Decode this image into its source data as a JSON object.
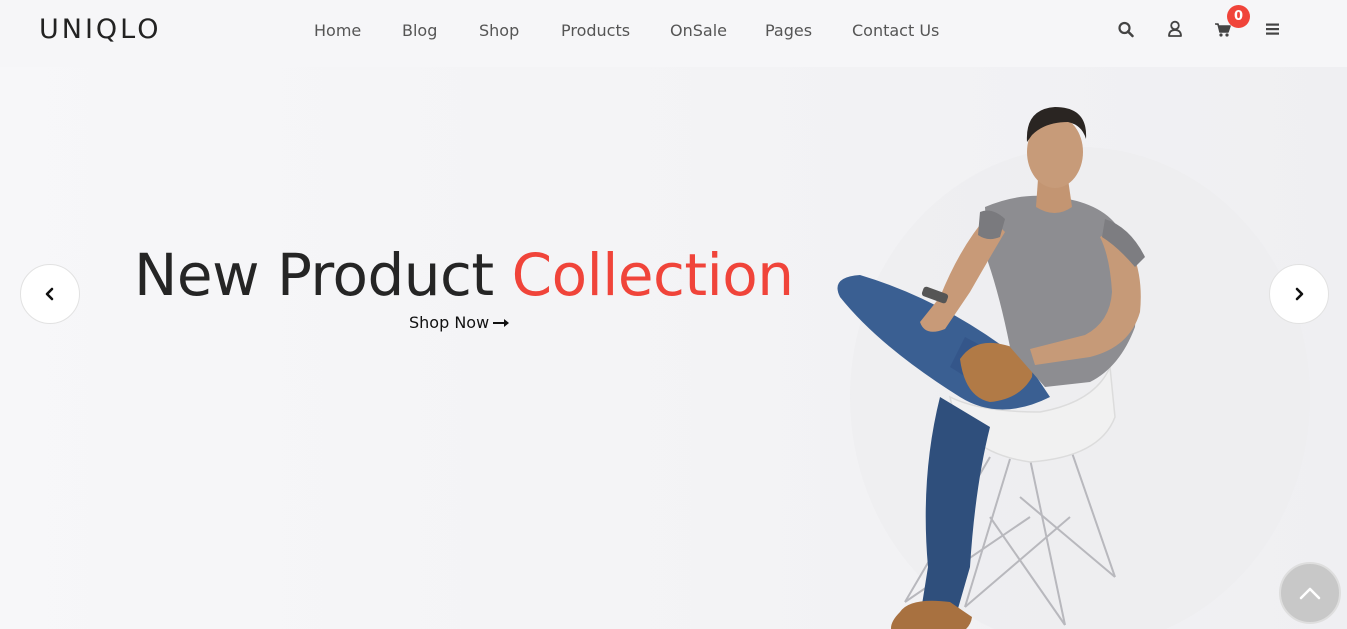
{
  "header": {
    "logo": "UNIQLO",
    "nav": [
      "Home",
      "Blog",
      "Shop",
      "Products",
      "OnSale",
      "Pages",
      "Contact Us"
    ],
    "cart_count": "0",
    "icons": [
      "search-icon",
      "user-icon",
      "cart-icon",
      "menu-icon"
    ]
  },
  "hero": {
    "headline_main": "New Product ",
    "headline_accent": "Collection",
    "cta_label": "Shop Now",
    "accent_color": "#f0443a"
  }
}
